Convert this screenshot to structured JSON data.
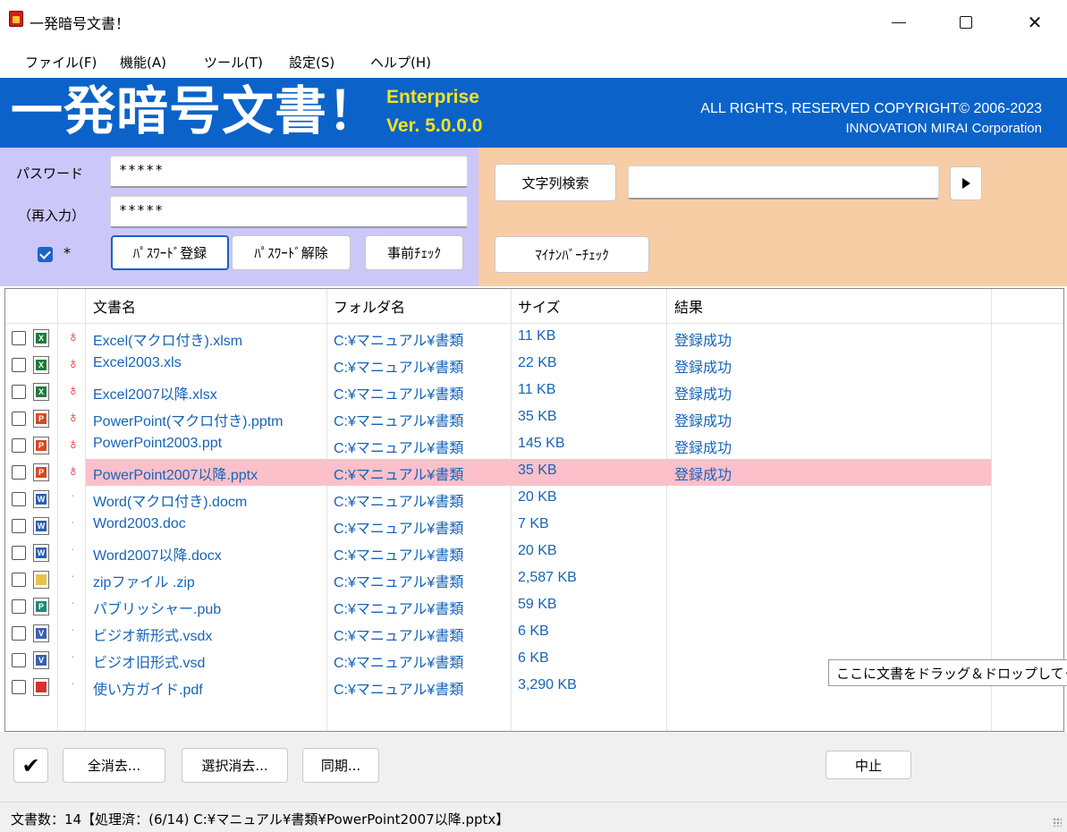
{
  "window": {
    "title": "一発暗号文書！"
  },
  "menu": [
    "ファイル(F)",
    "機能(A)",
    "ツール(T)",
    "設定(S)",
    "ヘルプ(H)"
  ],
  "banner": {
    "title": "一発暗号文書！",
    "edition": "Enterprise",
    "version": "Ver.  5.0.0.0",
    "copyright": "ALL RIGHTS, RESERVED COPYRIGHT© 2006-2023",
    "company": "INNOVATION MIRAI Corporation"
  },
  "password": {
    "label": "パスワード",
    "confirm_label": "（再入力）",
    "value": "*****",
    "confirm_value": "*****",
    "show_checkbox_checked": true,
    "show_label": "*",
    "register_button": "ﾊﾟｽﾜｰﾄﾞ登録",
    "release_button": "ﾊﾟｽﾜｰﾄﾞ解除",
    "precheck_button": "事前ﾁｪｯｸ"
  },
  "search": {
    "button": "文字列検索",
    "value": "",
    "mynumber_button": "ﾏｲﾅﾝﾊﾞｰﾁｪｯｸ"
  },
  "table": {
    "headers": [
      "文書名",
      "フォルダ名",
      "サイズ",
      "結果"
    ],
    "rows": [
      {
        "name": "Excel(マクロ付き).xlsm",
        "folder": "C:¥マニュアル¥書類",
        "size": "11 KB",
        "result": "登録成功",
        "type": "excel",
        "locked": true
      },
      {
        "name": "Excel2003.xls",
        "folder": "C:¥マニュアル¥書類",
        "size": "22 KB",
        "result": "登録成功",
        "type": "excel",
        "locked": true
      },
      {
        "name": "Excel2007以降.xlsx",
        "folder": "C:¥マニュアル¥書類",
        "size": "11 KB",
        "result": "登録成功",
        "type": "excel",
        "locked": true
      },
      {
        "name": "PowerPoint(マクロ付き).pptm",
        "folder": "C:¥マニュアル¥書類",
        "size": "35 KB",
        "result": "登録成功",
        "type": "ppt",
        "locked": true
      },
      {
        "name": "PowerPoint2003.ppt",
        "folder": "C:¥マニュアル¥書類",
        "size": "145 KB",
        "result": "登録成功",
        "type": "ppt",
        "locked": true
      },
      {
        "name": "PowerPoint2007以降.pptx",
        "folder": "C:¥マニュアル¥書類",
        "size": "35 KB",
        "result": "登録成功",
        "type": "ppt",
        "locked": true,
        "selected": true
      },
      {
        "name": "Word(マクロ付き).docm",
        "folder": "C:¥マニュアル¥書類",
        "size": "20 KB",
        "result": "",
        "type": "word",
        "locked": false
      },
      {
        "name": "Word2003.doc",
        "folder": "C:¥マニュアル¥書類",
        "size": "7 KB",
        "result": "",
        "type": "word",
        "locked": false
      },
      {
        "name": "Word2007以降.docx",
        "folder": "C:¥マニュアル¥書類",
        "size": "20 KB",
        "result": "",
        "type": "word",
        "locked": false
      },
      {
        "name": "zipファイル .zip",
        "folder": "C:¥マニュアル¥書類",
        "size": "2,587 KB",
        "result": "",
        "type": "zip",
        "locked": false
      },
      {
        "name": "パブリッシャー.pub",
        "folder": "C:¥マニュアル¥書類",
        "size": "59 KB",
        "result": "",
        "type": "pub",
        "locked": false
      },
      {
        "name": "ビジオ新形式.vsdx",
        "folder": "C:¥マニュアル¥書類",
        "size": "6 KB",
        "result": "",
        "type": "visio",
        "locked": false
      },
      {
        "name": "ビジオ旧形式.vsd",
        "folder": "C:¥マニュアル¥書類",
        "size": "6 KB",
        "result": "",
        "type": "visio",
        "locked": false
      },
      {
        "name": "使い方ガイド.pdf",
        "folder": "C:¥マニュアル¥書類",
        "size": "3,290 KB",
        "result": "",
        "type": "pdf",
        "locked": false
      }
    ]
  },
  "tooltip": "ここに文書をドラッグ＆ドロップしてくだ",
  "bottom": {
    "check_label": "✔",
    "clear_all": "全消去...",
    "clear_selected": "選択消去...",
    "sync": "同期...",
    "stop": "中止"
  },
  "status": "文書数：14【処理済：(6/14) C:¥マニュアル¥書類¥PowerPoint2007以降.pptx】",
  "colors": {
    "banner_bg": "#0b63c9",
    "banner_accent": "#f9e21b",
    "password_panel": "#cbc7f8",
    "search_panel": "#f7cda6",
    "link_text": "#1664b8",
    "selected_row": "#fbc0ca",
    "key_icon": "#e01f1f"
  },
  "icons": {
    "excel": "excel-file-icon",
    "ppt": "powerpoint-file-icon",
    "word": "word-file-icon",
    "zip": "zip-file-icon",
    "pub": "publisher-file-icon",
    "visio": "visio-file-icon",
    "pdf": "pdf-file-icon",
    "lock": "red-key-icon"
  }
}
